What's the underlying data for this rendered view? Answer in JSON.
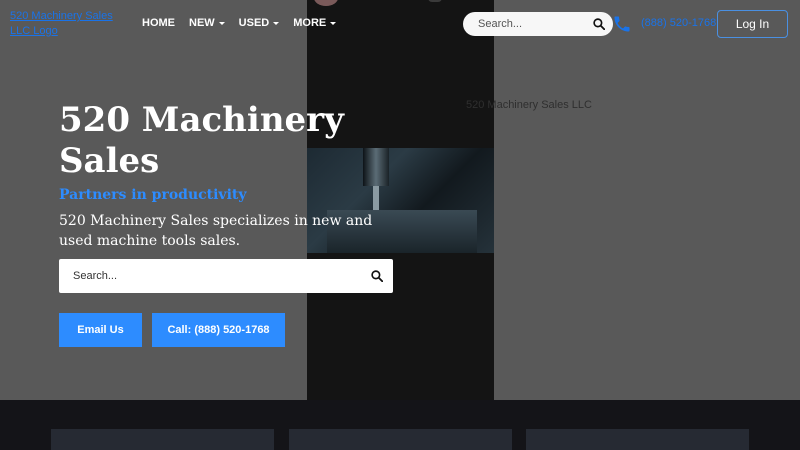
{
  "header": {
    "logo_text": "520 Machinery Sales LLC Logo",
    "nav": [
      {
        "label": "HOME",
        "has_dropdown": false
      },
      {
        "label": "NEW",
        "has_dropdown": true
      },
      {
        "label": "USED",
        "has_dropdown": true
      },
      {
        "label": "MORE",
        "has_dropdown": true
      }
    ],
    "search_placeholder": "Search...",
    "phone": "(888) 520-1768",
    "login_label": "Log In"
  },
  "hero": {
    "image_alt": "520 Machinery Sales LLC",
    "title": "520 Machinery Sales",
    "tagline": "Partners in productivity",
    "description": "520 Machinery Sales specializes in new and used machine tools sales.",
    "search_placeholder": "Search...",
    "email_label": "Email Us",
    "call_label": "Call: (888) 520-1768"
  },
  "colors": {
    "accent": "#2d8cff",
    "link": "#1a73e8",
    "hero_bg": "#595959",
    "dark_bg": "#141418",
    "card_bg": "#262a33"
  },
  "icons": {
    "search": "search-icon",
    "phone": "phone-icon",
    "caret": "caret-down-icon"
  }
}
